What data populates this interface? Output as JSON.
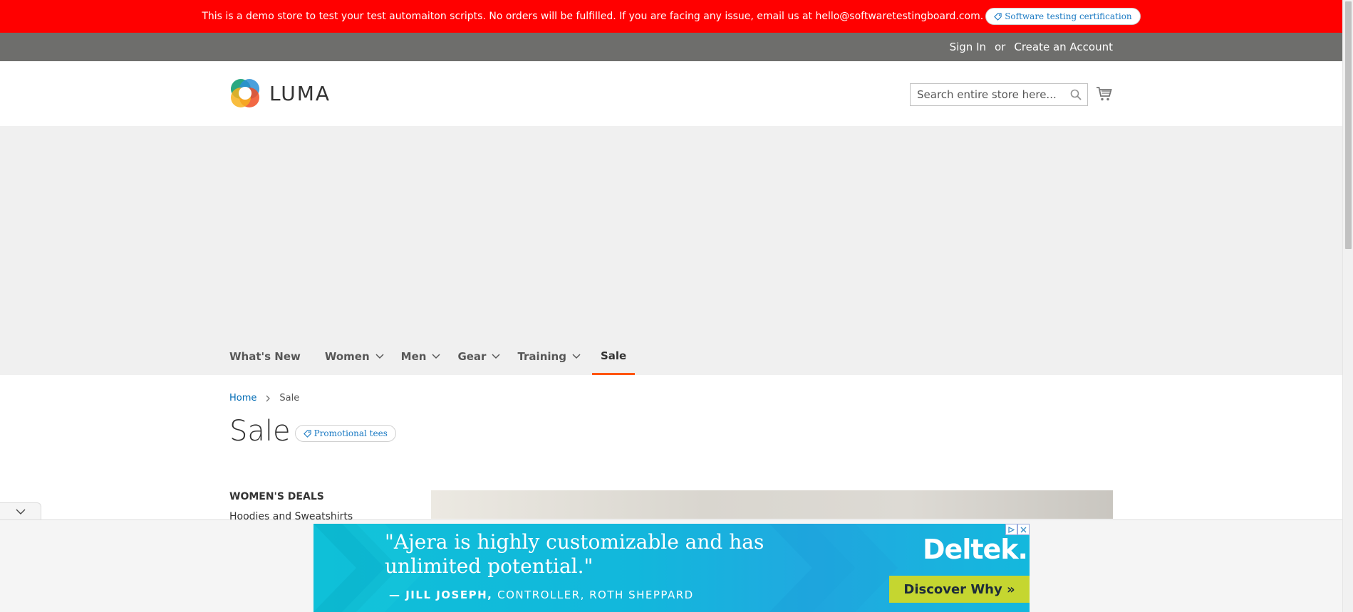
{
  "demo_banner": {
    "message": "This is a demo store to test your test automaiton scripts. No orders will be fulfilled. If you are facing any issue, email us at hello@softwaretestingboard.com.",
    "pill_label": "Software testing certification"
  },
  "header_panel": {
    "sign_in": "Sign In",
    "or": "or",
    "create_account": "Create an Account"
  },
  "logo": {
    "text": "LUMA"
  },
  "search": {
    "placeholder": "Search entire store here..."
  },
  "nav": {
    "items": [
      {
        "label": "What's New"
      },
      {
        "label": "Women"
      },
      {
        "label": "Men"
      },
      {
        "label": "Gear"
      },
      {
        "label": "Training"
      },
      {
        "label": "Sale"
      }
    ]
  },
  "breadcrumb": {
    "home": "Home",
    "current": "Sale"
  },
  "page": {
    "title": "Sale",
    "tag_label": "Promotional tees"
  },
  "sidebar": {
    "title": "WOMEN'S DEALS",
    "items": [
      {
        "label": "Hoodies and Sweatshirts"
      }
    ]
  },
  "ad": {
    "quote": "\"Ajera is highly customizable and has unlimited potential.\"",
    "author_name": "— JILL JOSEPH,",
    "author_role": "CONTROLLER, ROTH SHEPPARD",
    "brand": "Deltek.",
    "cta": "Discover Why »"
  },
  "colors": {
    "banner_red": "#ff0000",
    "panel_gray": "#6e6e6c",
    "nav_active_underline": "#ff5501",
    "link_blue": "#006bb4",
    "ad_cyan": "#12b7dc",
    "ad_cta_green": "#c5d630"
  }
}
